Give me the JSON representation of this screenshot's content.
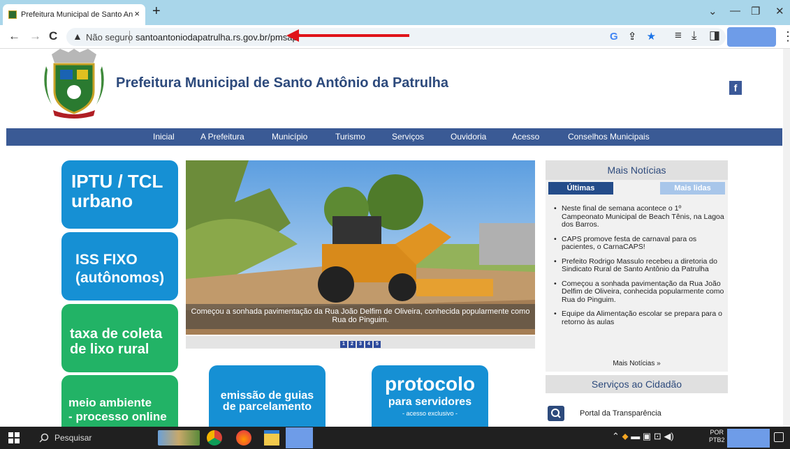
{
  "browser": {
    "tab_title": "Prefeitura Municipal de Santo An",
    "tab_close": "×",
    "new_tab": "+",
    "nav_back": "←",
    "nav_forward": "→",
    "nav_reload": "C",
    "security_icon": "▲",
    "security_label": "Não seguro",
    "url": "santoantoniodapatrulha.rs.gov.br/pmsap/"
  },
  "site": {
    "title": "Prefeitura Municipal de Santo Antônio da Patrulha",
    "facebook": "f",
    "nav": [
      "Inicial",
      "A Prefeitura",
      "Município",
      "Turismo",
      "Serviços",
      "Ouvidoria",
      "Acesso",
      "Conselhos Municipais"
    ],
    "tiles": {
      "iptu": [
        "IPTU / TCL",
        "urbano"
      ],
      "iss": [
        "ISS FIXO",
        "(autônomos)"
      ],
      "lixo": [
        "taxa de coleta",
        "de lixo rural"
      ],
      "meio": [
        "meio ambiente",
        "- processo online"
      ],
      "guias": [
        "emissão de guias",
        "de parcelamento"
      ],
      "protocolo": [
        "protocolo",
        "para servidores",
        "- acesso exclusivo -"
      ]
    },
    "slider": {
      "caption": "Começou a sonhada pavimentação da Rua João Delfim de Oliveira, conhecida popularmente como Rua do Pinguim.",
      "pages": [
        "1",
        "2",
        "3",
        "4",
        "5"
      ]
    },
    "news": {
      "heading": "Mais Notícias",
      "tab_ultimas": "Últimas",
      "tab_mais_lidas": "Mais lidas",
      "items": [
        "Neste final de semana acontece o 1º Campeonato Municipal de Beach Tênis, na Lagoa dos Barros.",
        "CAPS promove festa de carnaval para os pacientes, o CarnaCAPS!",
        "Prefeito Rodrigo Massulo recebeu a diretoria do Sindicato Rural de Santo Antônio da Patrulha",
        "Começou a sonhada pavimentação da Rua João Delfim de Oliveira, conhecida popularmente como Rua do Pinguim.",
        "Equipe da Alimentação escolar se prepara para o retorno às aulas"
      ],
      "more": "Mais Notícias »"
    },
    "services": {
      "heading": "Serviços ao Cidadão",
      "portal": "Portal da Transparência"
    }
  },
  "taskbar": {
    "search": "Pesquisar",
    "lang1": "POR",
    "lang2": "PTB2"
  }
}
